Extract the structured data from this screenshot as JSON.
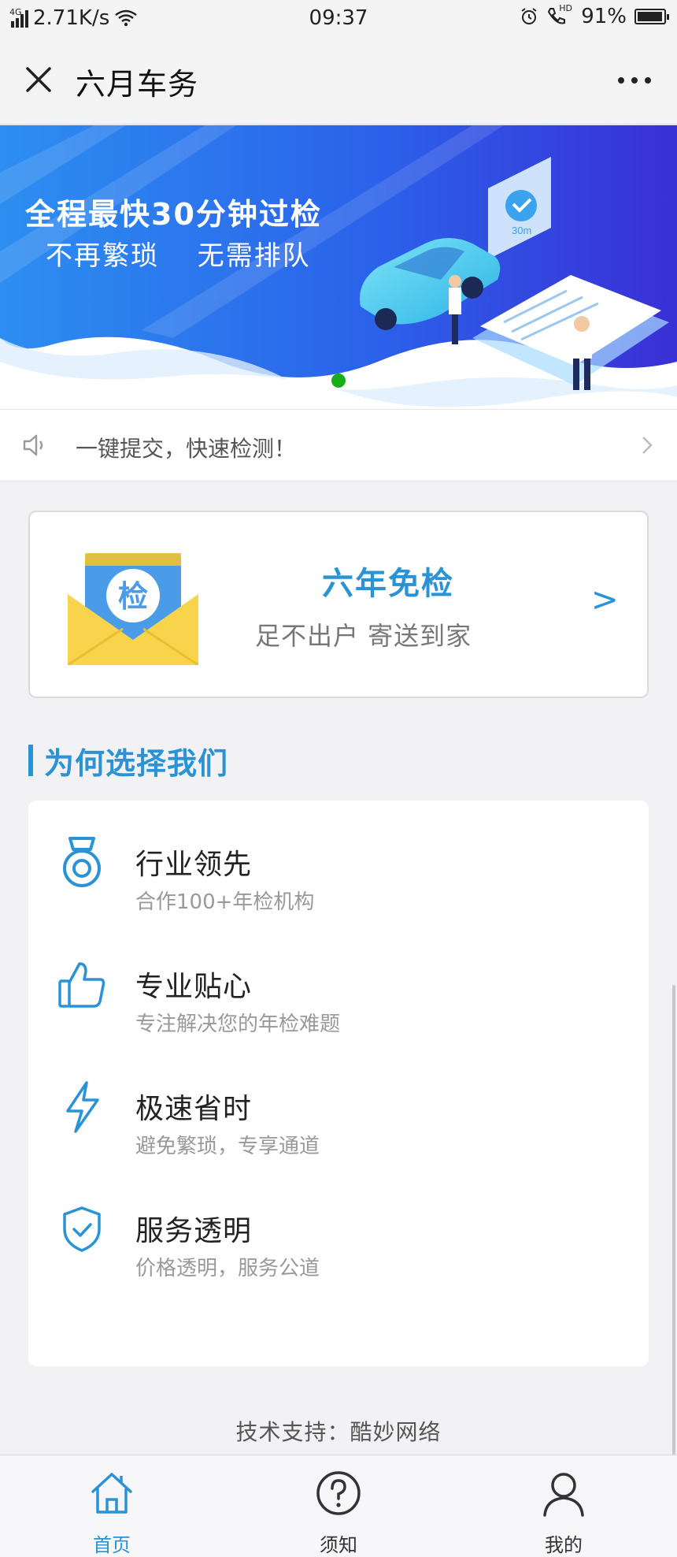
{
  "status_bar": {
    "network": "4G",
    "speed": "2.71K/s",
    "time": "09:37",
    "hd_label": "HD",
    "battery": "91%"
  },
  "title_bar": {
    "title": "六月车务",
    "close_icon": "close-icon",
    "more_icon": "more-icon"
  },
  "banner": {
    "line1": "全程最快30分钟过检",
    "line2": "不再繁琐 无需排队",
    "timer_label": "30m",
    "pager_active_color": "#1aad19"
  },
  "notice": {
    "text": "一键提交，快速检测！"
  },
  "promo": {
    "badge": "检",
    "title": "六年免检",
    "subtitle": "足不出户 寄送到家",
    "arrow": ">"
  },
  "section": {
    "title": "为何选择我们"
  },
  "features": [
    {
      "icon": "medal-icon",
      "title": "行业领先",
      "desc": "合作100+年检机构"
    },
    {
      "icon": "thumbs-up-icon",
      "title": "专业贴心",
      "desc": "专注解决您的年检难题"
    },
    {
      "icon": "lightning-icon",
      "title": "极速省时",
      "desc": "避免繁琐，专享通道"
    },
    {
      "icon": "shield-check-icon",
      "title": "服务透明",
      "desc": "价格透明，服务公道"
    }
  ],
  "footer": {
    "text": "技术支持：酷妙网络"
  },
  "tabs": [
    {
      "icon": "home-icon",
      "label": "首页",
      "active": true
    },
    {
      "icon": "question-icon",
      "label": "须知",
      "active": false
    },
    {
      "icon": "user-icon",
      "label": "我的",
      "active": false
    }
  ],
  "colors": {
    "accent": "#2a93d5",
    "banner_blue": "#2b5fe8"
  }
}
